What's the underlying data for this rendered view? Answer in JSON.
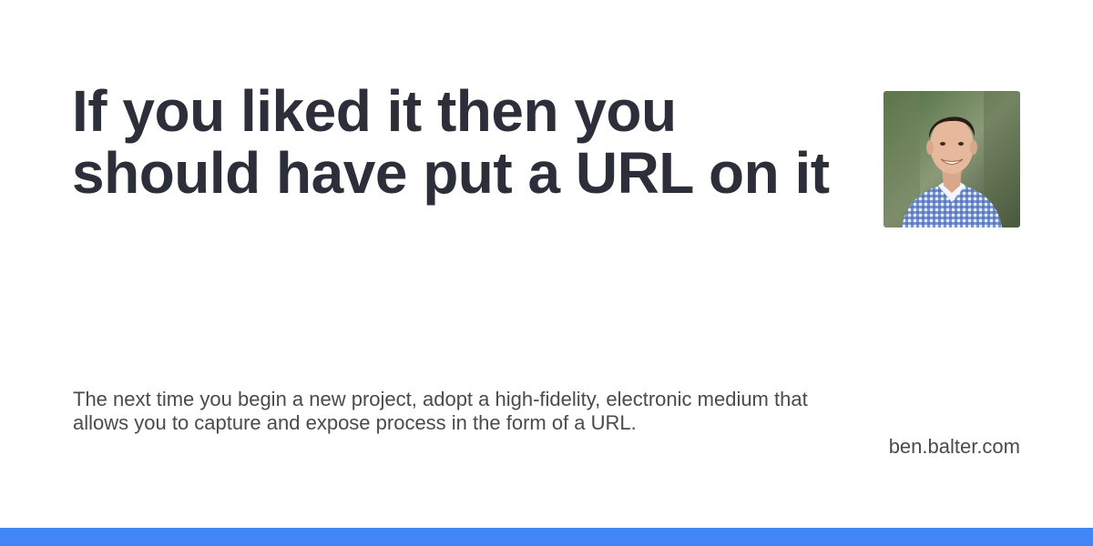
{
  "card": {
    "title": "If you liked it then you should have put a URL on it",
    "description": "The next time you begin a new project, adopt a high-fidelity, electronic medium that allows you to capture and expose process in the form of a URL.",
    "site": "ben.balter.com",
    "avatar_alt": "author-avatar-photo"
  },
  "colors": {
    "accent": "#4285f4",
    "title": "#2c2f3a",
    "body_text": "#4a4a4f",
    "background": "#ffffff"
  }
}
